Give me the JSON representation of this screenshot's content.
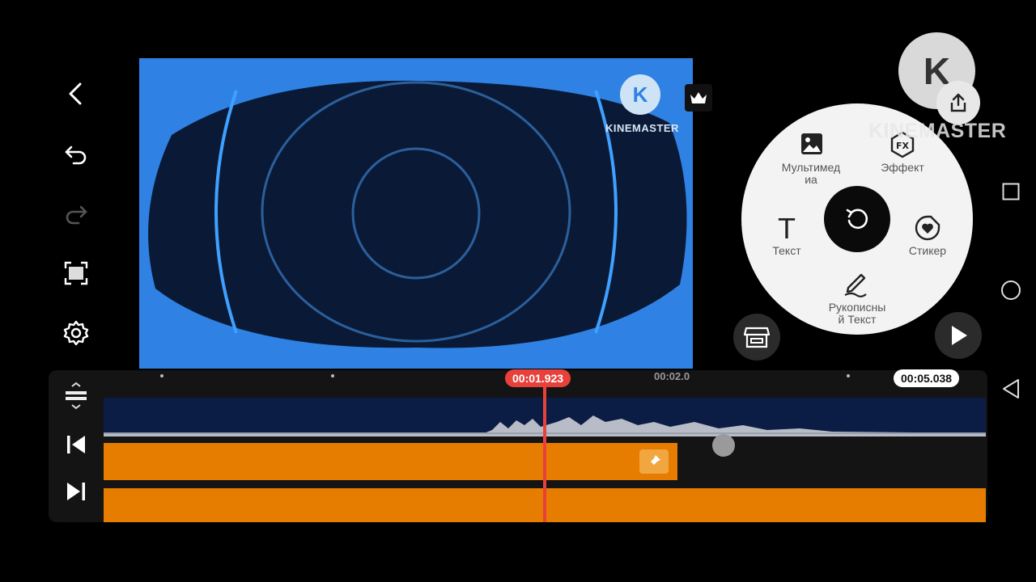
{
  "preview": {
    "watermark_small": "KINEMASTER",
    "watermark_large": "KINEMASTER",
    "logo_letter": "K"
  },
  "wheel": {
    "media_label": "Мультимед\nиа",
    "effect_label": "Эффект",
    "text_label": "Текст",
    "sticker_label": "Стикер",
    "handwriting_label": "Рукописны\nй Текст",
    "fx_glyph": "FX",
    "text_glyph": "T"
  },
  "timeline": {
    "current_time": "00:01.923",
    "ruler_mark": "00:02.0",
    "total_time": "00:05.038"
  },
  "colors": {
    "accent_orange": "#e67c00",
    "playhead_red": "#e8413c",
    "preview_blue": "#2f82e3",
    "wheel_bg": "#f3f3f3"
  }
}
